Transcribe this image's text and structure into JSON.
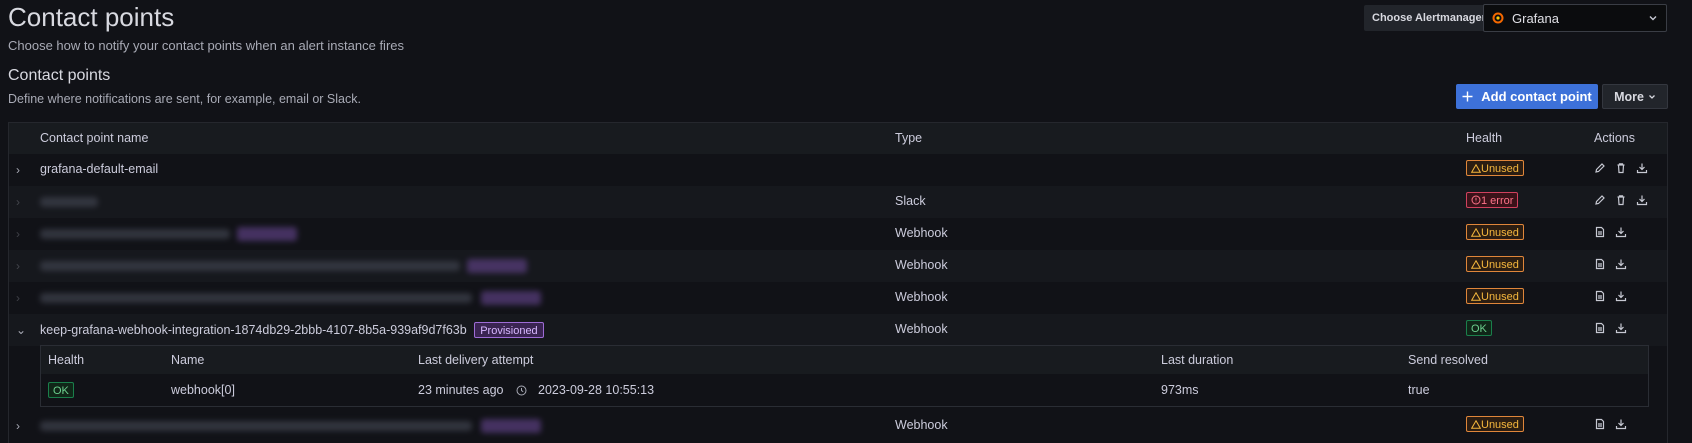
{
  "header": {
    "title": "Contact points",
    "subtitle": "Choose how to notify your contact points when an alert instance fires",
    "alertmanager_label": "Choose Alertmanager",
    "alertmanager_value": "Grafana"
  },
  "section": {
    "title": "Contact points",
    "subtitle": "Define where notifications are sent, for example, email or Slack.",
    "add_label": "Add contact point",
    "more_label": "More"
  },
  "table": {
    "columns": {
      "name": "Contact point name",
      "type": "Type",
      "health": "Health",
      "actions": "Actions"
    },
    "rows": [
      {
        "name": "grafana-default-email",
        "type": "",
        "health": "Unused"
      },
      {
        "name": "",
        "type": "Slack",
        "health": "1 error"
      },
      {
        "name": "",
        "type": "Webhook",
        "health": "Unused"
      },
      {
        "name": "",
        "type": "Webhook",
        "health": "Unused"
      },
      {
        "name": "",
        "type": "Webhook",
        "health": "Unused"
      },
      {
        "name": "keep-grafana-webhook-integration-1874db29-2bbb-4107-8b5a-939af9d7f63b",
        "tag": "Provisioned",
        "type": "Webhook",
        "health": "OK"
      },
      {
        "name": "",
        "type": "Webhook",
        "health": "Unused"
      }
    ],
    "detail": {
      "columns": {
        "health": "Health",
        "name": "Name",
        "last_delivery": "Last delivery attempt",
        "last_duration": "Last duration",
        "send_resolved": "Send resolved"
      },
      "row": {
        "health": "OK",
        "name": "webhook[0]",
        "ago": "23 minutes ago",
        "timestamp": "2023-09-28 10:55:13",
        "duration": "973ms",
        "send_resolved": "true"
      }
    }
  },
  "colors": {
    "primary": "#3d71d9",
    "unused": "#f5b73d",
    "error": "#ff7389",
    "ok": "#6ccf8e",
    "provisioned": "#9e6cd6"
  }
}
